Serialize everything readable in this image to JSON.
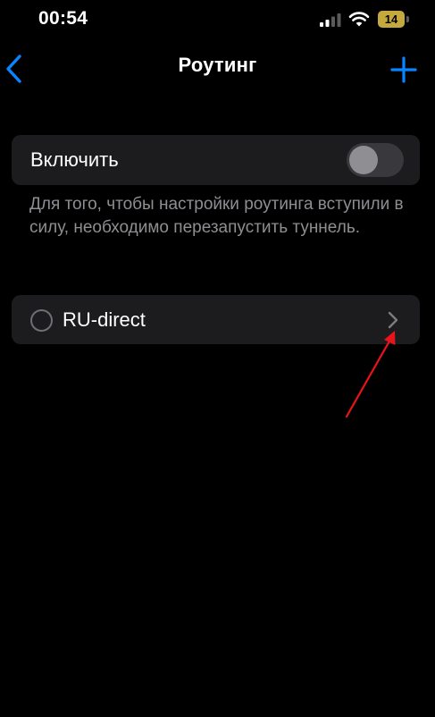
{
  "status_bar": {
    "time": "00:54",
    "battery_level": "14",
    "battery_color": "#c6a93d",
    "icons": [
      "signal-icon",
      "wifi-icon",
      "battery-icon"
    ]
  },
  "nav": {
    "title": "Роутинг",
    "back_icon": "chevron-left-icon",
    "add_icon": "plus-icon",
    "accent_color": "#0a84ff"
  },
  "enable_section": {
    "label": "Включить",
    "toggle_on": false,
    "footer": "Для того, чтобы настройки роутинга вступили в силу, необходимо перезапустить туннель."
  },
  "routes": [
    {
      "name": "RU-direct",
      "selected": false,
      "chevron_icon": "chevron-right-icon"
    }
  ],
  "annotation": {
    "type": "arrow",
    "color": "#e8141b",
    "points_to": "route-chevron"
  }
}
